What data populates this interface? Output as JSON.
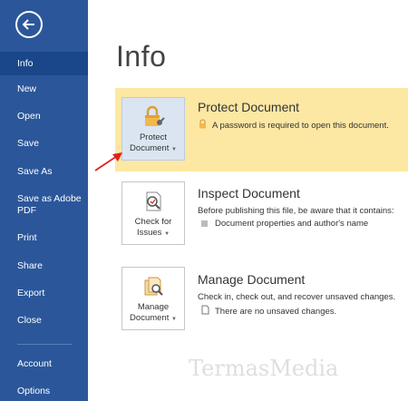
{
  "sidebar": {
    "items": [
      {
        "label": "Info"
      },
      {
        "label": "New"
      },
      {
        "label": "Open"
      },
      {
        "label": "Save"
      },
      {
        "label": "Save As"
      },
      {
        "label": "Save as Adobe\nPDF"
      },
      {
        "label": "Print"
      },
      {
        "label": "Share"
      },
      {
        "label": "Export"
      },
      {
        "label": "Close"
      },
      {
        "label": "Account"
      },
      {
        "label": "Options"
      }
    ]
  },
  "main": {
    "title": "Info",
    "protect": {
      "button_label_1": "Protect",
      "button_label_2": "Document",
      "title": "Protect Document",
      "desc": "A password is required to open this document."
    },
    "inspect": {
      "button_label_1": "Check for",
      "button_label_2": "Issues",
      "title": "Inspect Document",
      "desc": "Before publishing this file, be aware that it contains:",
      "bullet": "Document properties and author's name"
    },
    "manage": {
      "button_label_1": "Manage",
      "button_label_2": "Document",
      "title": "Manage Document",
      "desc": "Check in, check out, and recover unsaved changes.",
      "bullet": "There are no unsaved changes."
    }
  },
  "watermark": "TermasMedia",
  "colors": {
    "sidebar": "#2b579a",
    "sidebar_active": "#19478a",
    "highlight": "#fce7a3",
    "arrow": "#e02020"
  }
}
